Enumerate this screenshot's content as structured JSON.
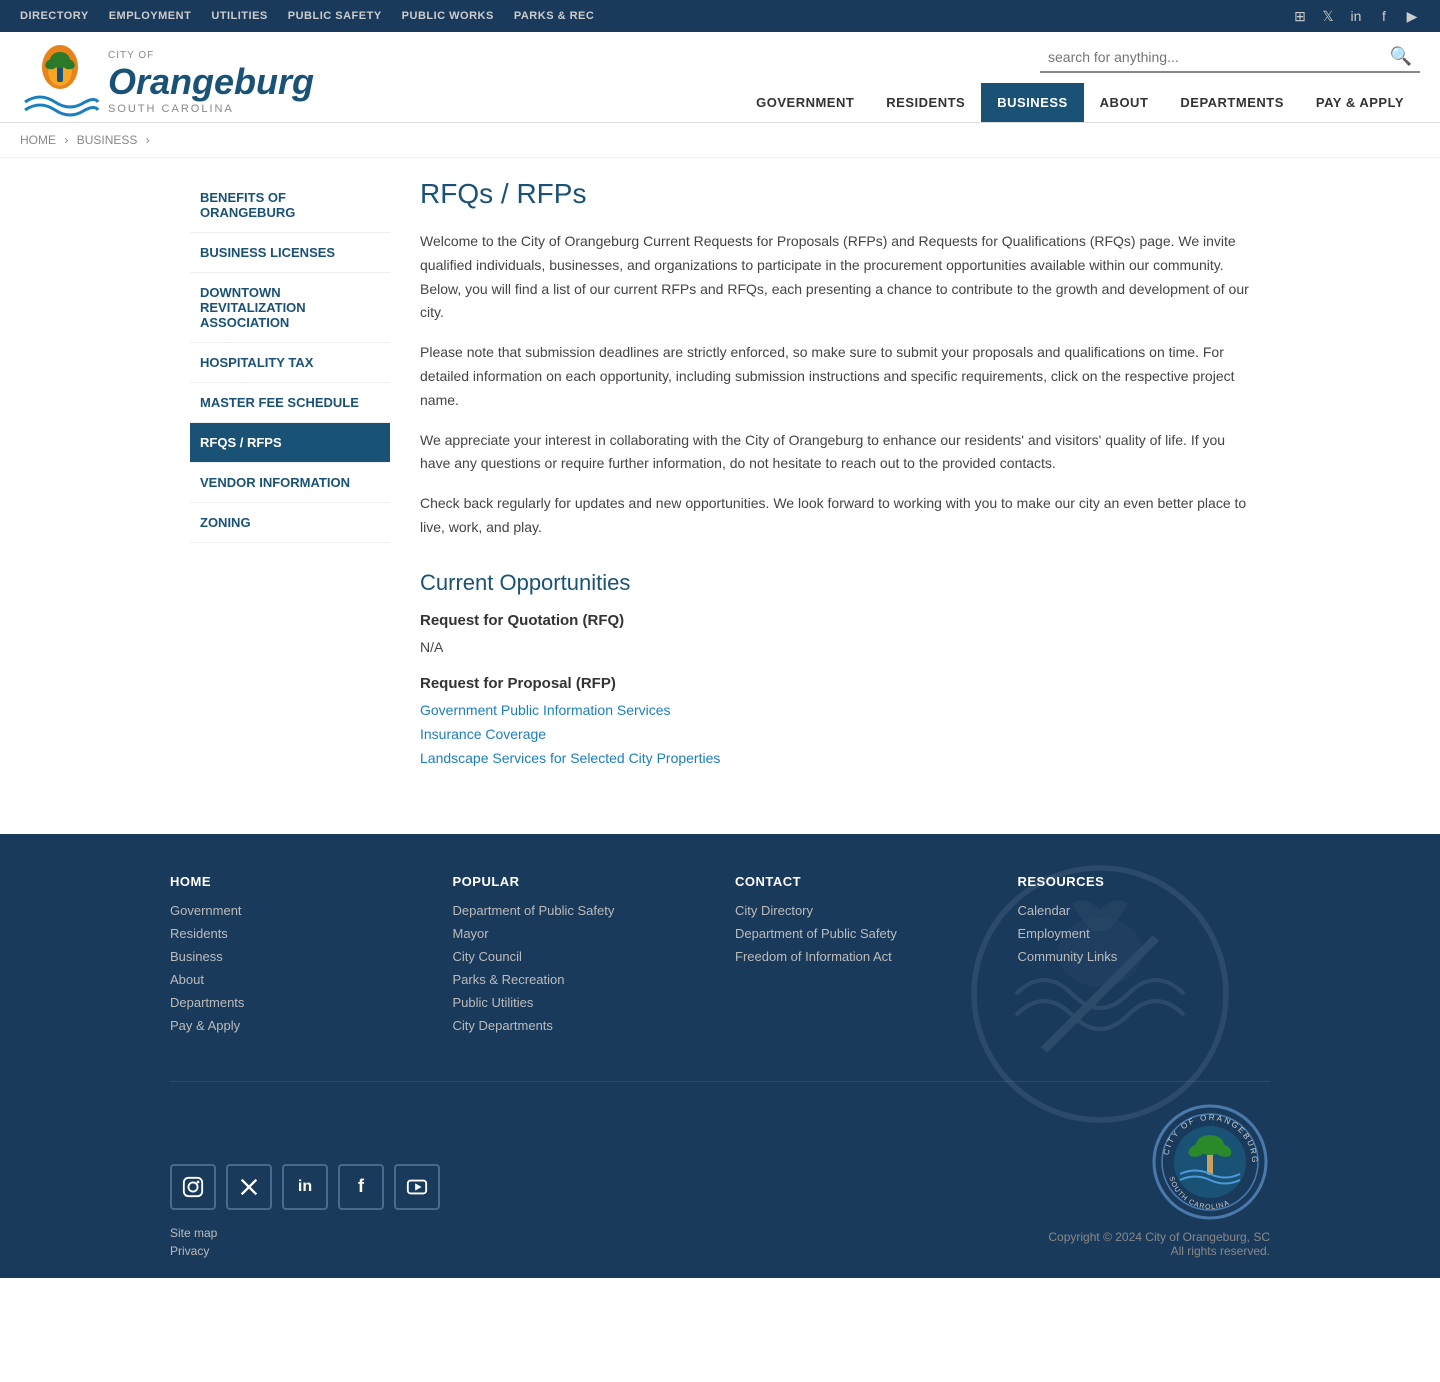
{
  "topbar": {
    "links": [
      "DIRECTORY",
      "EMPLOYMENT",
      "UTILITIES",
      "PUBLIC SAFETY",
      "PUBLIC WORKS",
      "PARKS & REC"
    ],
    "social": [
      "instagram",
      "twitter",
      "linkedin",
      "facebook",
      "youtube"
    ]
  },
  "header": {
    "city_of": "CITY OF",
    "title": "Orangeburg",
    "state": "SOUTH CAROLINA",
    "search_placeholder": "search for anything..."
  },
  "mainnav": {
    "items": [
      {
        "label": "GOVERNMENT",
        "active": false
      },
      {
        "label": "RESIDENTS",
        "active": false
      },
      {
        "label": "BUSINESS",
        "active": true
      },
      {
        "label": "ABOUT",
        "active": false
      },
      {
        "label": "DEPARTMENTS",
        "active": false
      },
      {
        "label": "PAY & APPLY",
        "active": false
      }
    ]
  },
  "breadcrumb": {
    "items": [
      "HOME",
      "BUSINESS"
    ]
  },
  "sidebar": {
    "items": [
      {
        "label": "BENEFITS OF ORANGEBURG",
        "active": false
      },
      {
        "label": "BUSINESS LICENSES",
        "active": false
      },
      {
        "label": "DOWNTOWN REVITALIZATION ASSOCIATION",
        "active": false
      },
      {
        "label": "HOSPITALITY TAX",
        "active": false
      },
      {
        "label": "MASTER FEE SCHEDULE",
        "active": false
      },
      {
        "label": "RFQS / RFPS",
        "active": true
      },
      {
        "label": "VENDOR INFORMATION",
        "active": false
      },
      {
        "label": "ZONING",
        "active": false
      }
    ]
  },
  "page": {
    "title": "RFQs / RFPs",
    "intro1": "Welcome to the City of Orangeburg Current Requests for Proposals (RFPs) and Requests for Qualifications (RFQs) page. We invite qualified individuals, businesses, and organizations to participate in the procurement opportunities available within our community. Below, you will find a list of our current RFPs and RFQs, each presenting a chance to contribute to the growth and development of our city.",
    "intro2": "Please note that submission deadlines are strictly enforced, so make sure to submit your proposals and qualifications on time. For detailed information on each opportunity, including submission instructions and specific requirements, click on the respective project name.",
    "intro3": "We appreciate your interest in collaborating with the City of Orangeburg to enhance our residents' and visitors' quality of life. If you have any questions or require further information, do not hesitate to reach out to the provided contacts.",
    "intro4": "Check back regularly for updates and new opportunities. We look forward to working with you to make our city an even better place to live, work, and play.",
    "current_opps_title": "Current Opportunities",
    "rfq_label": "Request for Quotation (RFQ)",
    "rfq_value": "N/A",
    "rfp_label": "Request for Proposal (RFP)",
    "rfp_links": [
      {
        "label": "Government Public Information Services",
        "url": "#"
      },
      {
        "label": "Insurance Coverage",
        "url": "#"
      },
      {
        "label": "Landscape Services for Selected City Properties",
        "url": "#"
      }
    ]
  },
  "footer": {
    "home_label": "HOME",
    "home_links": [
      "Government",
      "Residents",
      "Business",
      "About",
      "Departments",
      "Pay & Apply"
    ],
    "popular_label": "POPULAR",
    "popular_links": [
      "Department of Public Safety",
      "Mayor",
      "City Council",
      "Parks & Recreation",
      "Public Utilities",
      "City Departments"
    ],
    "contact_label": "CONTACT",
    "contact_links": [
      "City Directory",
      "Department of Public Safety",
      "Freedom of Information Act"
    ],
    "resources_label": "RESOURCES",
    "resources_links": [
      "Calendar",
      "Employment",
      "Community Links"
    ],
    "social_icons": [
      "instagram",
      "twitter",
      "linkedin",
      "facebook",
      "youtube"
    ],
    "sitemap_label": "Site map",
    "privacy_label": "Privacy",
    "copyright": "Copyright © 2024 City of Orangeburg, SC",
    "all_rights": "All rights reserved."
  }
}
